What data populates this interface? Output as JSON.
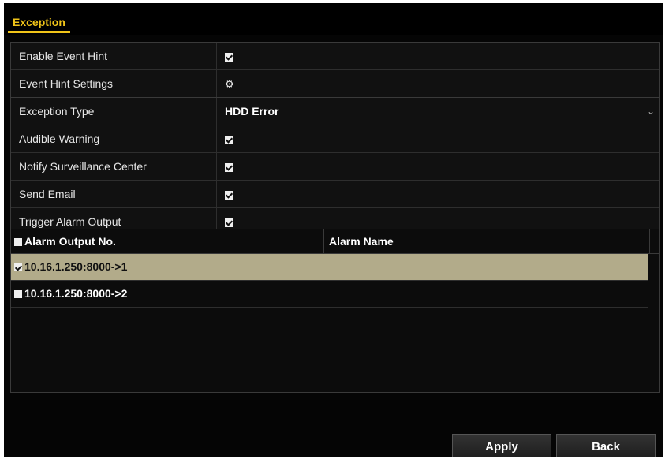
{
  "window": {
    "tab_label": "Exception"
  },
  "event_hint": {
    "enable": {
      "label": "Enable Event Hint",
      "checked": true
    },
    "settings": {
      "label": "Event Hint Settings",
      "icon": "gear-icon"
    }
  },
  "exception": {
    "type": {
      "label": "Exception Type",
      "value": "HDD Error",
      "icon": "chevron-down-icon"
    },
    "audible_warning": {
      "label": "Audible Warning",
      "checked": true
    },
    "notify_center": {
      "label": "Notify Surveillance Center",
      "checked": true
    },
    "send_email": {
      "label": "Send Email",
      "checked": true
    },
    "trigger_alarm": {
      "label": "Trigger Alarm Output",
      "checked": true
    }
  },
  "alarm_table": {
    "columns": [
      "Alarm Output No.",
      "Alarm Name"
    ],
    "header_checked": false,
    "rows": [
      {
        "output": "10.16.1.250:8000->1",
        "name": "",
        "checked": true,
        "selected": true
      },
      {
        "output": "10.16.1.250:8000->2",
        "name": "",
        "checked": false,
        "selected": false
      }
    ]
  },
  "buttons": {
    "apply": "Apply",
    "back": "Back"
  },
  "colors": {
    "accent": "#f0c419",
    "selected_row": "#b2ab8a",
    "background": "#050505"
  }
}
